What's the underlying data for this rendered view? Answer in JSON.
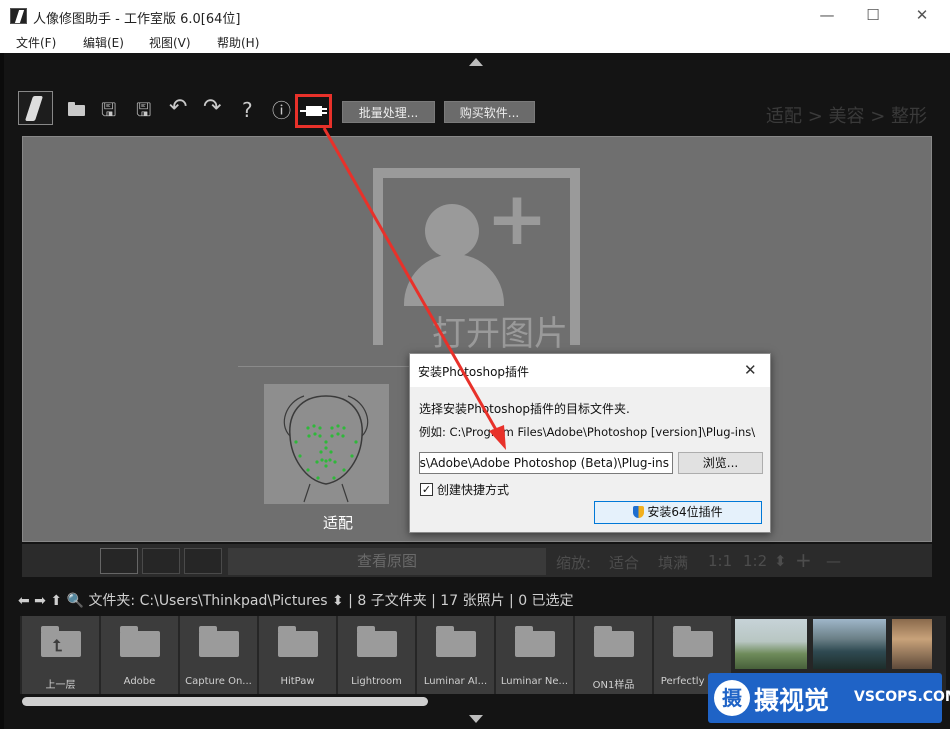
{
  "window": {
    "title": "人像修图助手 - 工作室版 6.0[64位]",
    "minimize_glyph": "—",
    "maximize_glyph": "☐",
    "close_glyph": "✕"
  },
  "menu": [
    "文件(F)",
    "编辑(E)",
    "视图(V)",
    "帮助(H)"
  ],
  "toolbar": {
    "icons": [
      "logo-icon",
      "open-folder-icon",
      "save-icon",
      "save-as-icon",
      "undo-icon",
      "redo-icon",
      "help-icon",
      "info-icon",
      "plugin-icon"
    ],
    "save_glyph": "🖫",
    "save_as_glyph": "🖫",
    "undo_glyph": "↶",
    "redo_glyph": "↷",
    "help_glyph": "?",
    "info_glyph": "ⓘ",
    "batch_label": "批量处理...",
    "buy_label": "购买软件...",
    "breadcrumb": "适配 > 美容 > 整形",
    "highlight_color": "#e8312a"
  },
  "canvas": {
    "open_label": "打开图片",
    "plus_glyph": "+",
    "face_label": "适配"
  },
  "viewbar": {
    "view_original": "查看原图",
    "zoom_label": "缩放:",
    "fit": "适合",
    "fill": "填满",
    "ratio_1": "1:1",
    "ratio_2": "1:2",
    "stepper_glyph": "⬍",
    "plus_glyph": "+",
    "minus_glyph": "—"
  },
  "path": {
    "nav_glyphs": "⬅ ➡ ⬆ 🔍",
    "text": "文件夹: C:\\Users\\Thinkpad\\Pictures ⬍ | 8 子文件夹 | 17 张照片 | 0 已选定"
  },
  "filmstrip": {
    "items": [
      "上一层",
      "Adobe",
      "Capture On...",
      "HitPaw",
      "Lightroom",
      "Luminar AI...",
      "Luminar Ne...",
      "ON1样品",
      "Perfectly C..."
    ],
    "up_glyph": "⮤"
  },
  "dialog": {
    "title": "安装Photoshop插件",
    "close_glyph": "✕",
    "line1": "选择安装Photoshop插件的目标文件夹.",
    "line2": "例如: C:\\Program Files\\Adobe\\Photoshop [version]\\Plug-ins\\",
    "path_value": "C:\\Program Files\\Adobe\\Adobe Photoshop (Beta)\\Plug-ins",
    "browse_label": "浏览...",
    "shortcut_label": "创建快捷方式",
    "check_glyph": "✓",
    "install_label": "安装64位插件"
  },
  "watermark": {
    "logo_glyph": "摄",
    "text": "摄视觉",
    "small": "VSCOPS.COM"
  }
}
